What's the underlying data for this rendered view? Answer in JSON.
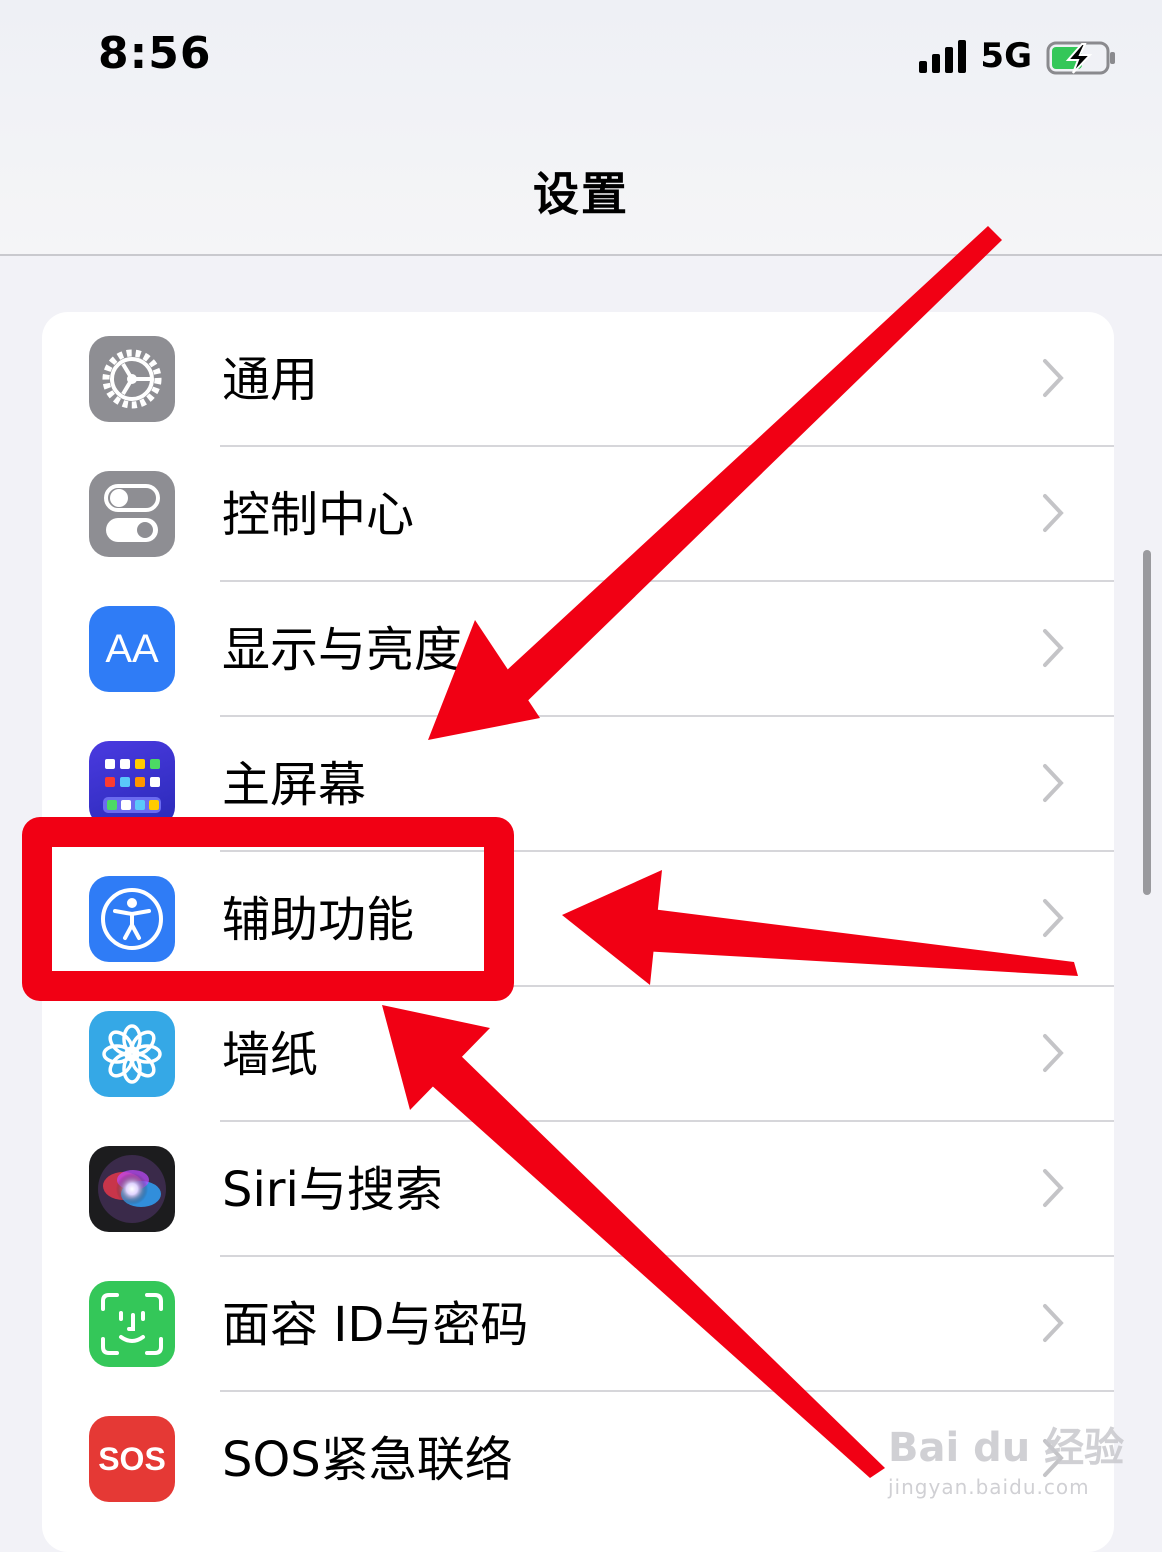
{
  "status_bar": {
    "time": "8:56",
    "network": "5G",
    "icons": [
      "signal-icon",
      "battery-charging-icon"
    ]
  },
  "nav": {
    "title": "设置"
  },
  "settings": [
    {
      "label": "通用",
      "icon": "gear-icon",
      "color": "#8e8e93"
    },
    {
      "label": "控制中心",
      "icon": "toggles-icon",
      "color": "#8e8e93"
    },
    {
      "label": "显示与亮度",
      "icon": "text-size-icon",
      "color": "#2f7cf6"
    },
    {
      "label": "主屏幕",
      "icon": "app-grid-icon",
      "color": "#3a3ad8"
    },
    {
      "label": "辅助功能",
      "icon": "accessibility-icon",
      "color": "#2f7cf6"
    },
    {
      "label": "墙纸",
      "icon": "flower-icon",
      "color": "#35a8e6"
    },
    {
      "label": "Siri与搜索",
      "icon": "siri-icon",
      "color": "#1c1c1e"
    },
    {
      "label": "面容 ID与密码",
      "icon": "face-id-icon",
      "color": "#34c759"
    },
    {
      "label": "SOS紧急联络",
      "icon": "sos-icon",
      "color": "#e53935"
    }
  ],
  "icon_text": {
    "display": "AA",
    "sos": "SOS"
  },
  "annotation": {
    "highlight_color": "#f10014",
    "highlighted_item": "辅助功能"
  },
  "watermark": {
    "main": "Bai du 经验",
    "sub": "jingyan.baidu.com"
  }
}
